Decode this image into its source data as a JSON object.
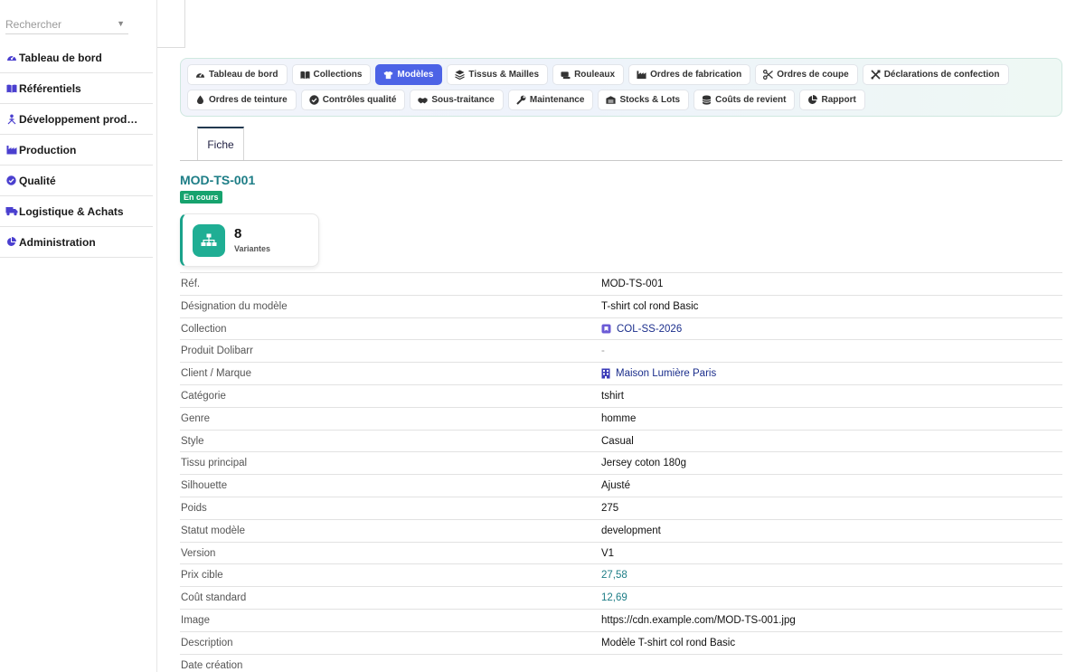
{
  "search": {
    "placeholder": "Rechercher"
  },
  "sidebar": {
    "items": [
      {
        "label": "Tableau de bord",
        "icon": "gauge-icon"
      },
      {
        "label": "Référentiels",
        "icon": "book-open-icon"
      },
      {
        "label": "Développement prod…",
        "icon": "user-network-icon"
      },
      {
        "label": "Production",
        "icon": "industry-icon"
      },
      {
        "label": "Qualité",
        "icon": "check-circle-icon"
      },
      {
        "label": "Logistique & Achats",
        "icon": "truck-icon"
      },
      {
        "label": "Administration",
        "icon": "pie-chart-icon"
      }
    ]
  },
  "modules": {
    "row1": [
      {
        "label": "Tableau de bord",
        "icon": "gauge-icon"
      },
      {
        "label": "Collections",
        "icon": "book-open-icon"
      },
      {
        "label": "Modèles",
        "icon": "tshirt-icon",
        "active": true
      },
      {
        "label": "Tissus & Mailles",
        "icon": "layers-icon"
      },
      {
        "label": "Rouleaux",
        "icon": "scroll-icon"
      },
      {
        "label": "Ordres de fabrication",
        "icon": "industry-icon"
      },
      {
        "label": "Ordres de coupe",
        "icon": "scissors-icon"
      },
      {
        "label": "Déclarations de confection",
        "icon": "tools-icon"
      }
    ],
    "row2": [
      {
        "label": "Ordres de teinture",
        "icon": "droplet-icon"
      },
      {
        "label": "Contrôles qualité",
        "icon": "check-circle-icon"
      },
      {
        "label": "Sous-traitance",
        "icon": "handshake-icon"
      },
      {
        "label": "Maintenance",
        "icon": "wrench-icon"
      },
      {
        "label": "Stocks & Lots",
        "icon": "warehouse-icon"
      },
      {
        "label": "Coûts de revient",
        "icon": "coins-icon"
      },
      {
        "label": "Rapport",
        "icon": "pie-chart-icon"
      }
    ]
  },
  "tabs": {
    "fiche": "Fiche"
  },
  "record": {
    "title": "MOD-TS-001",
    "status": "En cours",
    "stat_value": "8",
    "stat_label": "Variantes"
  },
  "fields": [
    {
      "label": "Réf.",
      "value": "MOD-TS-001"
    },
    {
      "label": "Désignation du modèle",
      "value": "T-shirt col rond Basic"
    },
    {
      "label": "Collection",
      "value": "COL-SS-2026",
      "type": "link",
      "icon": "collection-icon"
    },
    {
      "label": "Produit Dolibarr",
      "value": "-",
      "type": "muted"
    },
    {
      "label": "Client / Marque",
      "value": "Maison Lumière Paris",
      "type": "link",
      "icon": "building-icon"
    },
    {
      "label": "Catégorie",
      "value": "tshirt"
    },
    {
      "label": "Genre",
      "value": "homme"
    },
    {
      "label": "Style",
      "value": "Casual"
    },
    {
      "label": "Tissu principal",
      "value": "Jersey coton 180g"
    },
    {
      "label": "Silhouette",
      "value": "Ajusté"
    },
    {
      "label": "Poids",
      "value": "275"
    },
    {
      "label": "Statut modèle",
      "value": "development"
    },
    {
      "label": "Version",
      "value": "V1"
    },
    {
      "label": "Prix cible",
      "value": "27,58",
      "type": "teal"
    },
    {
      "label": "Coût standard",
      "value": "12,69",
      "type": "teal"
    },
    {
      "label": "Image",
      "value": "https://cdn.example.com/MOD-TS-001.jpg"
    },
    {
      "label": "Description",
      "value": "Modèle T-shirt col rond Basic"
    },
    {
      "label": "Date création",
      "value": ""
    }
  ],
  "colors": {
    "accent": "#4c63e6",
    "sidebar_icon": "#4a3fcf",
    "teal": "#1d7d86",
    "badge_green": "#16a36e",
    "link": "#1b2e8c"
  }
}
